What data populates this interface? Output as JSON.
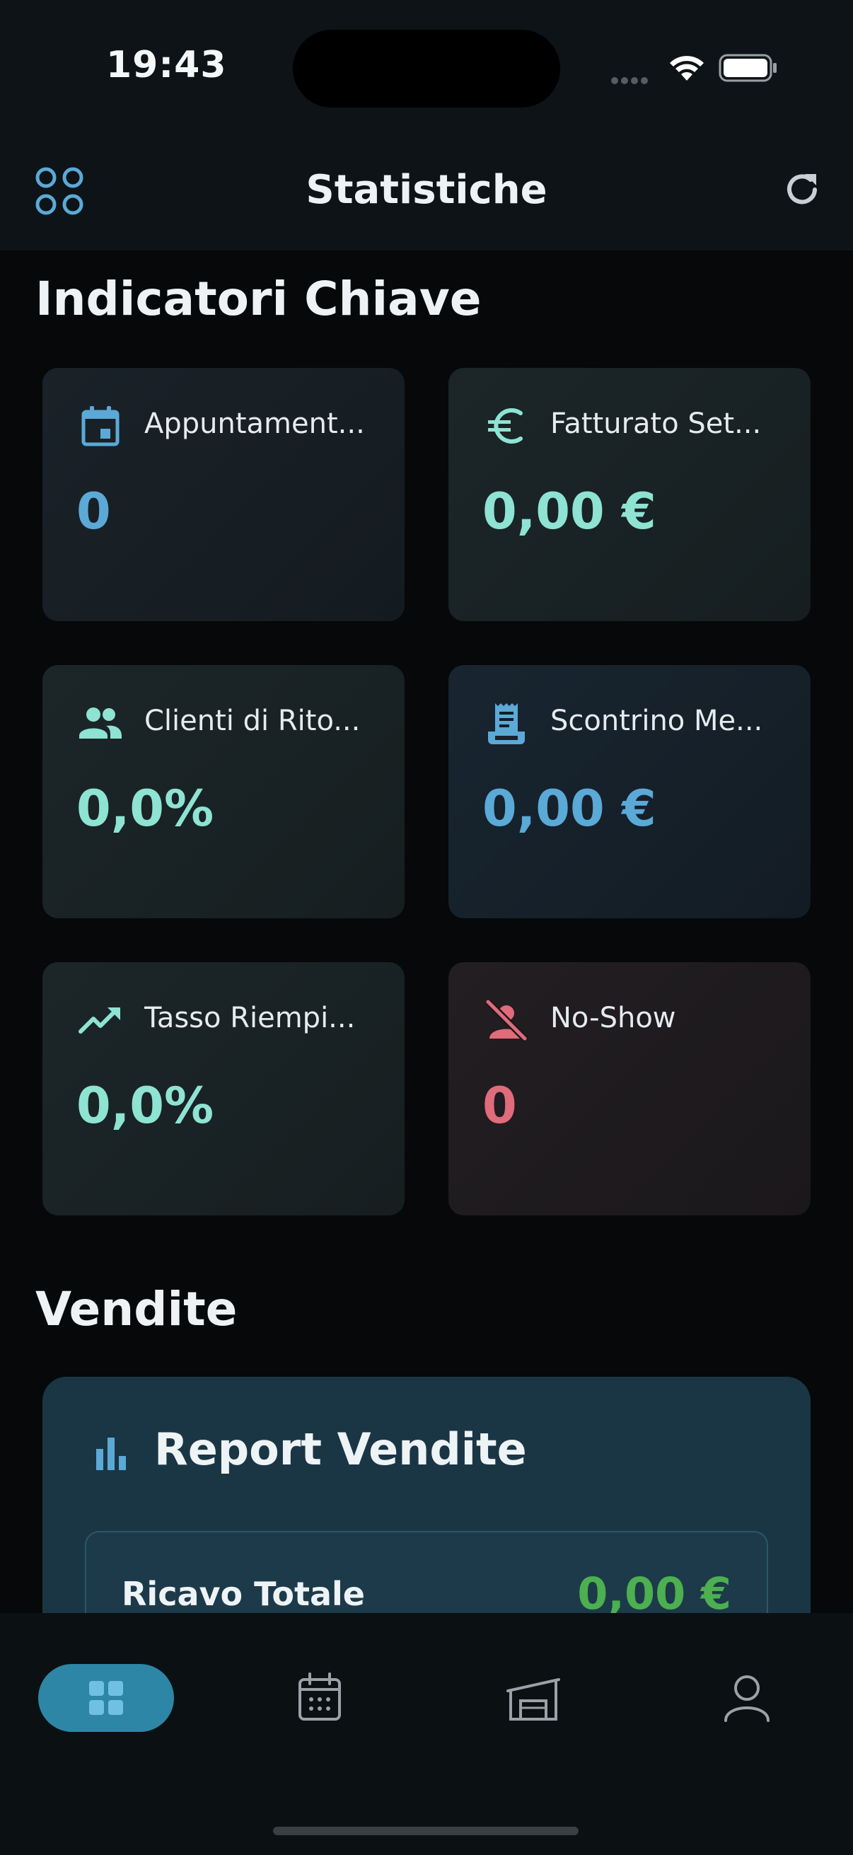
{
  "status_bar": {
    "time": "19:43"
  },
  "header": {
    "title": "Statistiche"
  },
  "sections": {
    "kpi_title": "Indicatori Chiave",
    "sales_title": "Vendite"
  },
  "kpis": [
    {
      "label": "Appuntament...",
      "value": "0",
      "icon": "calendar-icon",
      "color": "#5ba9d6"
    },
    {
      "label": "Fatturato Set...",
      "value": "0,00 €",
      "icon": "euro-icon",
      "color": "#8ee3d3"
    },
    {
      "label": "Clienti di Rito...",
      "value": "0,0%",
      "icon": "people-icon",
      "color": "#8ee3d3"
    },
    {
      "label": "Scontrino Me...",
      "value": "0,00 €",
      "icon": "receipt-icon",
      "color": "#5ba9d6"
    },
    {
      "label": "Tasso Riempi...",
      "value": "0,0%",
      "icon": "trending-up-icon",
      "color": "#8ee3d3"
    },
    {
      "label": "No-Show",
      "value": "0",
      "icon": "person-off-icon",
      "color": "#e06b7b"
    }
  ],
  "report": {
    "title": "Report Vendite",
    "icon": "bar-chart-icon",
    "total_label": "Ricavo Totale",
    "total_value": "0,00 €"
  },
  "nav": {
    "items": [
      "dashboard-icon",
      "calendar-icon",
      "store-icon",
      "profile-icon"
    ],
    "active": "dashboard-icon",
    "active_color": "#2d86a6"
  }
}
